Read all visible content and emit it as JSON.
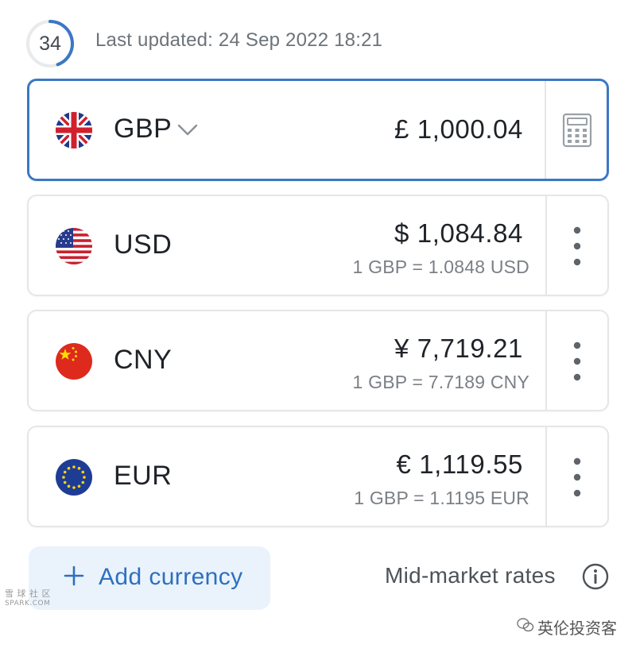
{
  "header": {
    "timer_seconds": "34",
    "last_updated": "Last updated: 24 Sep 2022 18:21"
  },
  "currencies": [
    {
      "code": "GBP",
      "flag_icon": "uk-flag-icon",
      "amount": "£ 1,000.04",
      "rate": "",
      "active": true,
      "action_icon": "calculator-icon"
    },
    {
      "code": "USD",
      "flag_icon": "us-flag-icon",
      "amount": "$ 1,084.84",
      "rate": "1 GBP = 1.0848 USD",
      "active": false,
      "action_icon": "more-vertical-icon"
    },
    {
      "code": "CNY",
      "flag_icon": "china-flag-icon",
      "amount": "¥ 7,719.21",
      "rate": "1 GBP = 7.7189 CNY",
      "active": false,
      "action_icon": "more-vertical-icon"
    },
    {
      "code": "EUR",
      "flag_icon": "eu-flag-icon",
      "amount": "€ 1,119.55",
      "rate": "1 GBP = 1.1195 EUR",
      "active": false,
      "action_icon": "more-vertical-icon"
    }
  ],
  "footer": {
    "add_currency_label": "Add currency",
    "mid_market_label": "Mid-market rates"
  },
  "watermarks": {
    "left_top": "雪 球 社 区",
    "left_bottom": "SPARK.COM",
    "right": "英伦投资客"
  },
  "colors": {
    "accent": "#3b78c4",
    "link": "#2e6fbf",
    "button_bg": "#eaf3fc",
    "card_border": "#e4e6e8",
    "muted_text": "#7b8086"
  }
}
